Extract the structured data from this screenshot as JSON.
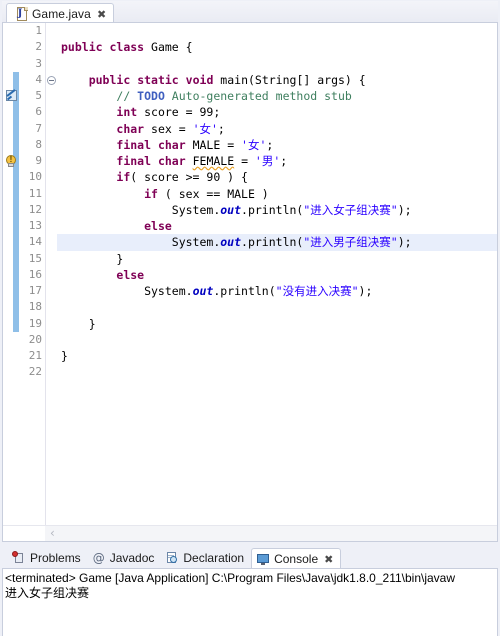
{
  "editor": {
    "tab": {
      "title": "Game.java",
      "icon": "java-file-icon",
      "close_glyph": "✄",
      "close_label": "✖"
    },
    "lines": [
      {
        "n": "1",
        "fold": false,
        "marker": null,
        "changed": false,
        "current": false
      },
      {
        "n": "2",
        "fold": false,
        "marker": null,
        "changed": false,
        "current": false
      },
      {
        "n": "3",
        "fold": false,
        "marker": null,
        "changed": false,
        "current": false
      },
      {
        "n": "4",
        "fold": true,
        "marker": null,
        "changed": true,
        "current": false
      },
      {
        "n": "5",
        "fold": false,
        "marker": "task",
        "changed": true,
        "current": false
      },
      {
        "n": "6",
        "fold": false,
        "marker": null,
        "changed": true,
        "current": false
      },
      {
        "n": "7",
        "fold": false,
        "marker": null,
        "changed": true,
        "current": false
      },
      {
        "n": "8",
        "fold": false,
        "marker": null,
        "changed": true,
        "current": false
      },
      {
        "n": "9",
        "fold": false,
        "marker": "warning",
        "changed": true,
        "current": false
      },
      {
        "n": "10",
        "fold": false,
        "marker": null,
        "changed": true,
        "current": false
      },
      {
        "n": "11",
        "fold": false,
        "marker": null,
        "changed": true,
        "current": false
      },
      {
        "n": "12",
        "fold": false,
        "marker": null,
        "changed": true,
        "current": false
      },
      {
        "n": "13",
        "fold": false,
        "marker": null,
        "changed": true,
        "current": false
      },
      {
        "n": "14",
        "fold": false,
        "marker": null,
        "changed": true,
        "current": true
      },
      {
        "n": "15",
        "fold": false,
        "marker": null,
        "changed": true,
        "current": false
      },
      {
        "n": "16",
        "fold": false,
        "marker": null,
        "changed": true,
        "current": false
      },
      {
        "n": "17",
        "fold": false,
        "marker": null,
        "changed": true,
        "current": false
      },
      {
        "n": "18",
        "fold": false,
        "marker": null,
        "changed": true,
        "current": false
      },
      {
        "n": "19",
        "fold": false,
        "marker": null,
        "changed": true,
        "current": false
      },
      {
        "n": "20",
        "fold": false,
        "marker": null,
        "changed": false,
        "current": false
      },
      {
        "n": "21",
        "fold": false,
        "marker": null,
        "changed": false,
        "current": false
      },
      {
        "n": "22",
        "fold": false,
        "marker": null,
        "changed": false,
        "current": false
      }
    ],
    "code": [
      "",
      "public class Game {",
      "",
      "    public static void main(String[] args) {",
      "        // TODO Auto-generated method stub",
      "        int score = 99;",
      "        char sex = '女';",
      "        final char MALE = '女';",
      "        final char FEMALE = '男';",
      "        if( score >= 90 ) {",
      "            if ( sex == MALE )",
      "                System.out.println(\"进入女子组决赛\");",
      "            else",
      "                System.out.println(\"进入男子组决赛\");",
      "        }",
      "        else",
      "            System.out.println(\"没有进入决赛\");",
      "",
      "    }",
      "",
      "}",
      ""
    ],
    "scrollbar": {
      "left_arrow": "‹"
    }
  },
  "console_view": {
    "tabs": [
      {
        "label": "Problems",
        "icon": "problems-icon",
        "active": false
      },
      {
        "label": "Javadoc",
        "icon": "javadoc-icon",
        "active": false
      },
      {
        "label": "Declaration",
        "icon": "declaration-icon",
        "active": false
      },
      {
        "label": "Console",
        "icon": "console-icon",
        "active": true
      }
    ],
    "close_glyph": "✖",
    "header": "<terminated> Game [Java Application] C:\\Program Files\\Java\\jdk1.8.0_211\\bin\\javaw",
    "output": "进入女子组决赛"
  },
  "colors": {
    "keyword": "#7f0055",
    "string": "#2a00ff",
    "comment": "#3f7f5f",
    "todo": "#3f5fbf",
    "field": "#0000c0",
    "current_line": "#e8eefb",
    "diff_bar": "#8fbfe8",
    "warning_underline": "#e9a227",
    "chrome": "#eef0f7",
    "border": "#c8cedd"
  }
}
